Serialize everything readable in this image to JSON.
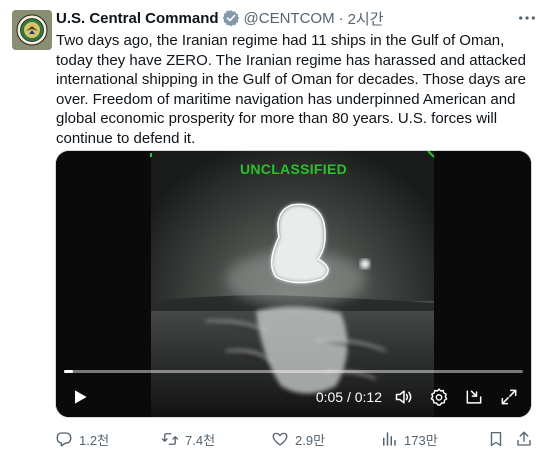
{
  "author": {
    "display_name": "U.S. Central Command",
    "handle": "@CENTCOM",
    "separator": "·",
    "time": "2시간",
    "verified_color": "#829aab"
  },
  "tweet": {
    "text": "Two days ago, the Iranian regime had 11 ships in the Gulf of Oman, today they have ZERO. The Iranian regime has harassed and attacked international shipping in the Gulf of Oman for decades. Those days are over. Freedom of maritime navigation has underpinned American and global economic prosperity for more than 80 years. U.S. forces will continue to defend it."
  },
  "video": {
    "overlay_label": "UNCLASSIFIED",
    "overlay_color": "#2bc12b",
    "timecode": "0:05 / 0:12",
    "progress_fraction": 0.005,
    "controls": [
      "play-icon",
      "volume-icon",
      "settings-icon",
      "pip-icon",
      "fullscreen-icon"
    ]
  },
  "actions": {
    "replies": "1.2천",
    "reposts": "7.4천",
    "likes": "2.9만",
    "views": "173만"
  },
  "colors": {
    "text_primary": "#0f1419",
    "text_secondary": "#536471"
  }
}
